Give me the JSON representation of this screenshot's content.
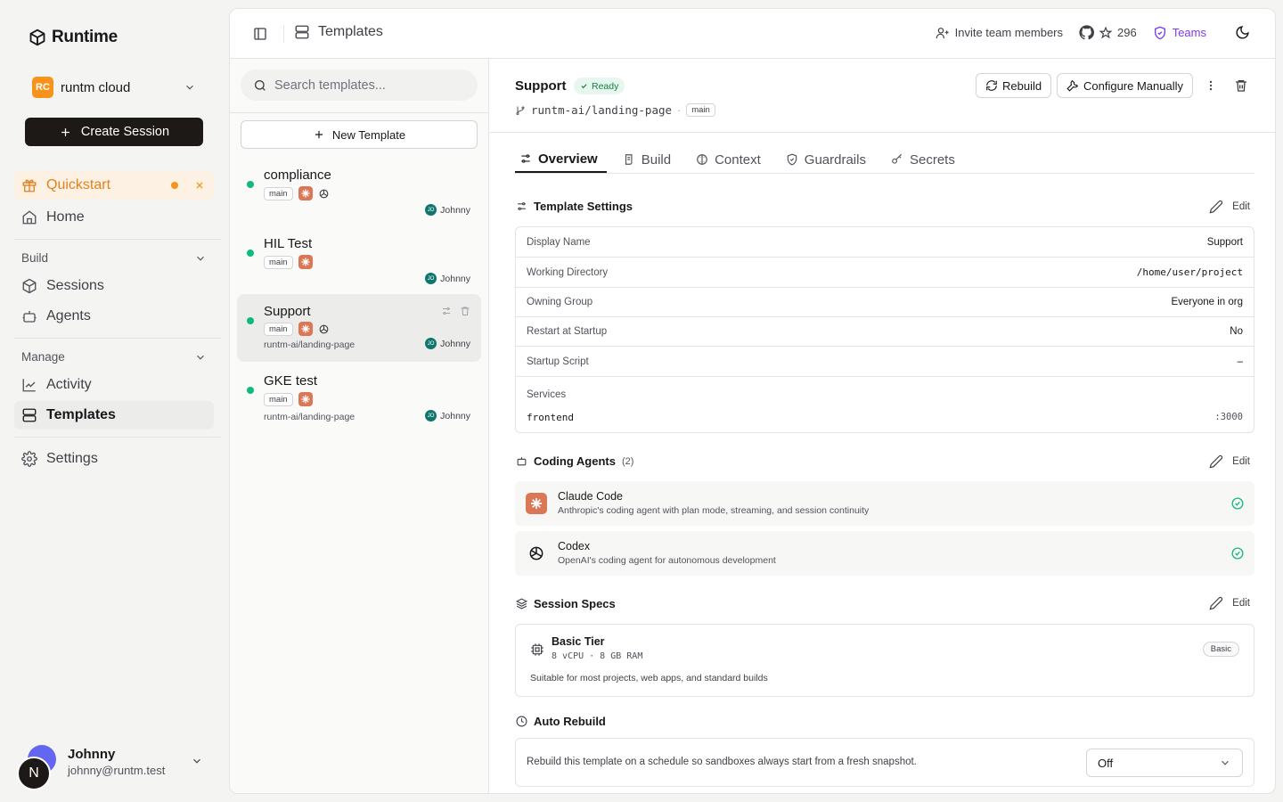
{
  "app": {
    "name": "Runtime"
  },
  "org": {
    "badge": "RC",
    "name": "runtm cloud"
  },
  "sidebar": {
    "create_label": "Create Session",
    "quickstart": "Quickstart",
    "home": "Home",
    "build_section": "Build",
    "sessions": "Sessions",
    "agents": "Agents",
    "manage_section": "Manage",
    "activity": "Activity",
    "templates": "Templates",
    "settings": "Settings"
  },
  "user": {
    "initial": "N",
    "name": "Johnny",
    "email": "johnny@runtm.test"
  },
  "topbar": {
    "title": "Templates",
    "invite": "Invite team members",
    "stars": "296",
    "teams": "Teams"
  },
  "list": {
    "search_placeholder": "Search templates...",
    "new_label": "New Template",
    "templates": [
      {
        "name": "compliance",
        "branch": "main",
        "repo": "",
        "owner_initials": "JO",
        "owner": "Johnny"
      },
      {
        "name": "HIL Test",
        "branch": "main",
        "repo": "",
        "owner_initials": "JO",
        "owner": "Johnny"
      },
      {
        "name": "Support",
        "branch": "main",
        "repo": "runtm-ai/landing-page",
        "owner_initials": "JO",
        "owner": "Johnny"
      },
      {
        "name": "GKE test",
        "branch": "main",
        "repo": "runtm-ai/landing-page",
        "owner_initials": "JO",
        "owner": "Johnny"
      }
    ]
  },
  "detail": {
    "name": "Support",
    "status": "Ready",
    "repo": "runtm-ai/landing-page",
    "branch": "main",
    "rebuild": "Rebuild",
    "configure": "Configure Manually",
    "tabs": [
      "Overview",
      "Build",
      "Context",
      "Guardrails",
      "Secrets"
    ],
    "settings_title": "Template Settings",
    "edit": "Edit",
    "settings": [
      {
        "label": "Display Name",
        "value": "Support"
      },
      {
        "label": "Working Directory",
        "value": "/home/user/project"
      },
      {
        "label": "Owning Group",
        "value": "Everyone in org"
      },
      {
        "label": "Restart at Startup",
        "value": "No"
      },
      {
        "label": "Startup Script",
        "value": "–"
      }
    ],
    "services_label": "Services",
    "service": {
      "name": "frontend",
      "port": ":3000"
    },
    "agents_title": "Coding Agents",
    "agents_count": "(2)",
    "agents": [
      {
        "name": "Claude Code",
        "desc": "Anthropic's coding agent with plan mode, streaming, and session continuity"
      },
      {
        "name": "Codex",
        "desc": "OpenAI's coding agent for autonomous development"
      }
    ],
    "specs_title": "Session Specs",
    "spec": {
      "tier": "Basic Tier",
      "resources": "8 vCPU · 8 GB RAM",
      "badge": "Basic",
      "desc": "Suitable for most projects, web apps, and standard builds"
    },
    "auto_title": "Auto Rebuild",
    "auto_desc": "Rebuild this template on a schedule so sandboxes always start from a fresh snapshot.",
    "auto_value": "Off"
  },
  "colors": {
    "accent_orange": "#f7931a",
    "quick_text": "#e0821e",
    "ready_green": "#15803d",
    "teams_purple": "#7c3aed",
    "claude": "#d97757"
  }
}
